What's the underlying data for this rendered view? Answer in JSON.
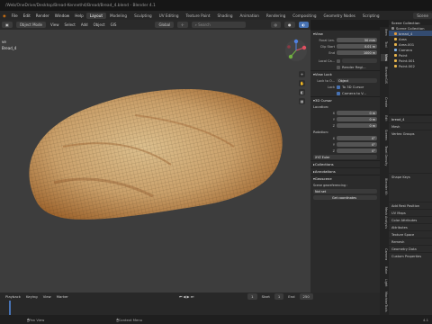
{
  "window": {
    "title": "/Web/OneDrive/Desktop/Bread-Kenneth4/Bread/Bread_4.blend - Blender 4.1"
  },
  "menu": {
    "items": [
      "File",
      "Edit",
      "Render",
      "Window",
      "Help"
    ],
    "workspaces": [
      "Layout",
      "Modeling",
      "Sculpting",
      "UV Editing",
      "Texture Paint",
      "Shading",
      "Animation",
      "Rendering",
      "Compositing",
      "Geometry Nodes",
      "Scripting"
    ],
    "active_workspace": "Layout",
    "scene": "Scene",
    "view_layer": "ViewLayer"
  },
  "viewport_header": {
    "mode": "Object Mode",
    "items": [
      "View",
      "Select",
      "Add",
      "Object"
    ],
    "gis": "GIS",
    "transform": "Global",
    "search_placeholder": "Search"
  },
  "viewport_overlay": {
    "lines": [
      "ve",
      "Bread_4",
      "",
      "",
      "",
      "",
      ""
    ]
  },
  "npanel": {
    "view_section": "View",
    "focal_length_label": "Focal Len.",
    "focal_length": "50 mm",
    "clip_start_label": "Clip Start",
    "clip_start": "0.01 m",
    "end_label": "End",
    "end": "1000 m",
    "local_camera_label": "Local Ca...",
    "render_region": "Render Regi...",
    "view_lock_section": "View Lock",
    "lock_to_object_label": "Lock to O...",
    "lock_to_object": "Object",
    "lock_label": "Lock",
    "to_3d_cursor": "To 3D Cursor",
    "camera_to_view": "Camera to V...",
    "cursor_section": "3D Cursor",
    "location_label": "Location:",
    "loc_x_label": "X",
    "loc_x": "0 m",
    "loc_y_label": "Y",
    "loc_y": "0 m",
    "loc_z_label": "Z",
    "loc_z": "0 m",
    "rotation_label": "Rotation:",
    "rot_x_label": "X",
    "rot_x": "0°",
    "rot_y_label": "Y",
    "rot_y": "0°",
    "rot_z_label": "Z",
    "rot_z": "0°",
    "rotation_mode": "XYZ Euler",
    "collections": "Collections",
    "annotations": "Annotations",
    "geoscene": "Geoscene",
    "georef_label": "Scene georeferencing :",
    "georef_value": "Not set",
    "get_coordinates": "Get coordinates"
  },
  "sidebar_tabs": [
    "Item",
    "Tool",
    "View",
    "BlenderGIS",
    "Create",
    "Edit",
    "Screen",
    "Texel Density",
    "Blender Kit",
    "Mesh Analysis",
    "Camera",
    "Bake",
    "Light",
    "MachineTools"
  ],
  "outliner": {
    "header": "Scene Collection",
    "items": [
      "Scene Collection",
      "bread_4",
      "Area",
      "Area.001",
      "Camera",
      "Point",
      "Point.001",
      "Point.002"
    ],
    "item_colors": [
      "#888888",
      "#e29b3a",
      "#e6b34a",
      "#e6b34a",
      "#7fb0e6",
      "#e6b34a",
      "#e6b34a",
      "#e6b34a"
    ]
  },
  "properties": {
    "object": "bread_4",
    "mesh": "Mesh",
    "sections": [
      "Vertex Groups",
      "Shape Keys",
      "Add Rest Position",
      "UV Maps",
      "Color Attributes",
      "Attributes",
      "Texture Space",
      "Remesh",
      "Geometry Data",
      "Custom Properties"
    ]
  },
  "timeline": {
    "items": [
      "Playback",
      "Keying",
      "View",
      "Marker"
    ],
    "current_frame": "1",
    "start_label": "Start",
    "start": "1",
    "end_label": "End",
    "end": "250"
  },
  "statusbar": {
    "left": "Pan View",
    "right": "Context Menu",
    "version": "4.1"
  },
  "colors": {
    "accent": "#4772b3",
    "bread_light": "#d9b57a",
    "bread_dark": "#a9682a"
  }
}
